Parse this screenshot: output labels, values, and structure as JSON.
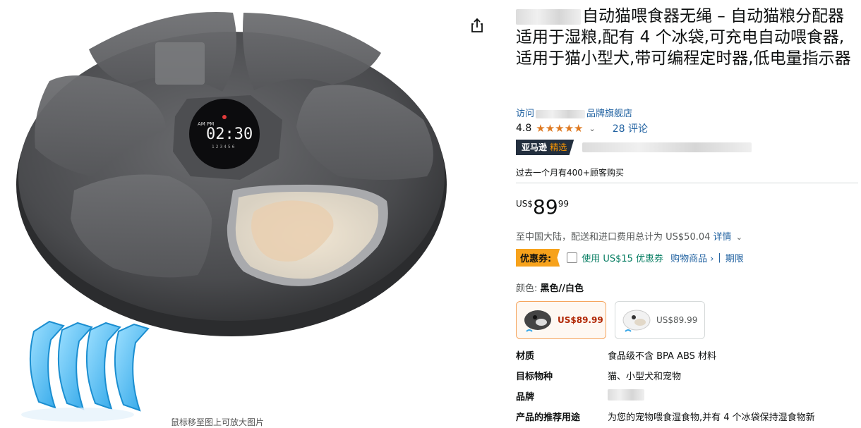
{
  "product": {
    "title": "自动猫喂食器无绳 – 自动猫粮分配器适用于湿粮,配有 4 个冰袋,可充电自动喂食器,适用于猫小型犬,带可编程定时器,低电量指示器",
    "store_prefix": "访问",
    "store_suffix": "品牌旗舰店",
    "rating": "4.8",
    "stars": "★★★★★",
    "reviews": "28 评论",
    "badge_brand": "亚马逊",
    "badge_choice": "精选",
    "bought": "过去一个月有400+顾客购买"
  },
  "device_display": {
    "ampm": "AM PM",
    "time": "02:30",
    "slots": "1 2 3 4 5 6"
  },
  "price": {
    "currency": "US$",
    "whole": "89",
    "fraction": "99"
  },
  "shipping": {
    "text": "至中国大陆，配送和进口费用总计为 US$50.04",
    "details": "详情"
  },
  "coupon": {
    "label": "优惠券:",
    "text": "使用 US$15 优惠券",
    "shop": "购物商品 ›",
    "sep": "|",
    "terms": "期限"
  },
  "color": {
    "label": "颜色:",
    "value": "黑色//白色",
    "options": [
      {
        "price": "US$89.99",
        "selected": true
      },
      {
        "price": "US$89.99",
        "selected": false
      }
    ]
  },
  "specs": [
    {
      "key": "材质",
      "value": "食品级不含 BPA ABS 材料"
    },
    {
      "key": "目标物种",
      "value": "猫、小型犬和宠物"
    },
    {
      "key": "品牌",
      "value": ""
    },
    {
      "key": "产品的推荐用途",
      "value": "为您的宠物喂食湿食物,并有 4 个冰袋保持湿食物新"
    }
  ],
  "hint": "鼠标移至图上可放大图片",
  "colors": {
    "link": "#2162a1",
    "star": "#de7921",
    "price_sale": "#b12704",
    "coupon": "#067d62"
  }
}
